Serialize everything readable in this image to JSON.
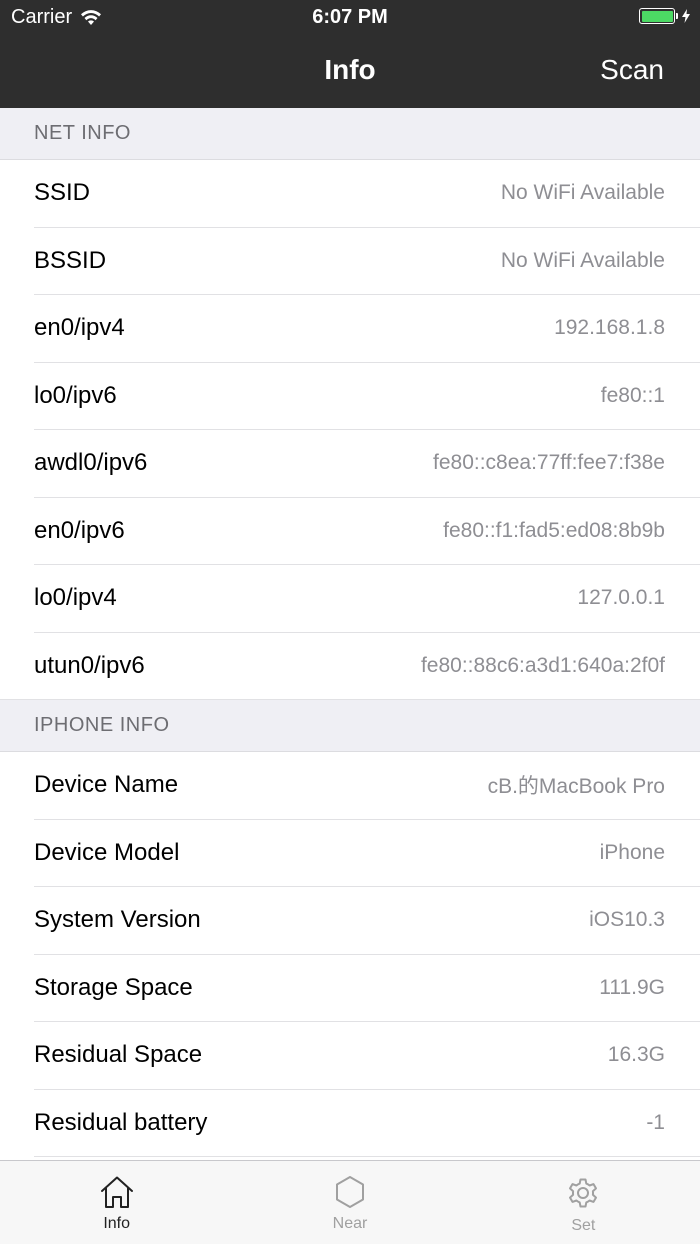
{
  "status_bar": {
    "carrier": "Carrier",
    "time": "6:07 PM"
  },
  "navbar": {
    "title": "Info",
    "action": "Scan"
  },
  "sections": {
    "net": {
      "header": "NET INFO",
      "rows": [
        {
          "label": "SSID",
          "value": "No WiFi Available"
        },
        {
          "label": "BSSID",
          "value": "No WiFi Available"
        },
        {
          "label": "en0/ipv4",
          "value": "192.168.1.8"
        },
        {
          "label": "lo0/ipv6",
          "value": "fe80::1"
        },
        {
          "label": "awdl0/ipv6",
          "value": "fe80::c8ea:77ff:fee7:f38e"
        },
        {
          "label": "en0/ipv6",
          "value": "fe80::f1:fad5:ed08:8b9b"
        },
        {
          "label": "lo0/ipv4",
          "value": "127.0.0.1"
        },
        {
          "label": "utun0/ipv6",
          "value": "fe80::88c6:a3d1:640a:2f0f"
        }
      ]
    },
    "iphone": {
      "header": "IPHONE INFO",
      "rows": [
        {
          "label": "Device Name",
          "value": "cB.的MacBook Pro"
        },
        {
          "label": "Device Model",
          "value": "iPhone"
        },
        {
          "label": "System Version",
          "value": "iOS10.3"
        },
        {
          "label": "Storage Space",
          "value": "111.9G"
        },
        {
          "label": "Residual Space",
          "value": "16.3G"
        },
        {
          "label": "Residual battery",
          "value": "-1"
        }
      ]
    }
  },
  "tabbar": {
    "tabs": [
      {
        "label": "Info",
        "icon": "home-icon",
        "active": true
      },
      {
        "label": "Near",
        "icon": "hexagon-icon",
        "active": false
      },
      {
        "label": "Set",
        "icon": "gear-icon",
        "active": false
      }
    ]
  },
  "colors": {
    "navbar_bg": "#2e2e2e",
    "battery_fill": "#4cd964",
    "section_bg": "#efeff4",
    "value_text": "#8e8e93"
  }
}
